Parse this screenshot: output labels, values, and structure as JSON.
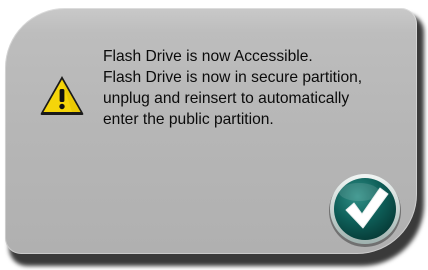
{
  "dialog": {
    "message_lines": [
      "Flash Drive  is now Accessible.",
      "Flash Drive is now in secure partition,",
      "unplug and reinsert to automatically",
      "enter the public partition."
    ],
    "icon": "warning-icon",
    "confirm_icon": "checkmark-icon"
  },
  "colors": {
    "dialog_background": "#b6b6b6",
    "warning_fill": "#f5d50a",
    "confirm_button": "#0e5e58",
    "confirm_button_ring": "#d7e3e1",
    "text": "#0b0b0b"
  }
}
